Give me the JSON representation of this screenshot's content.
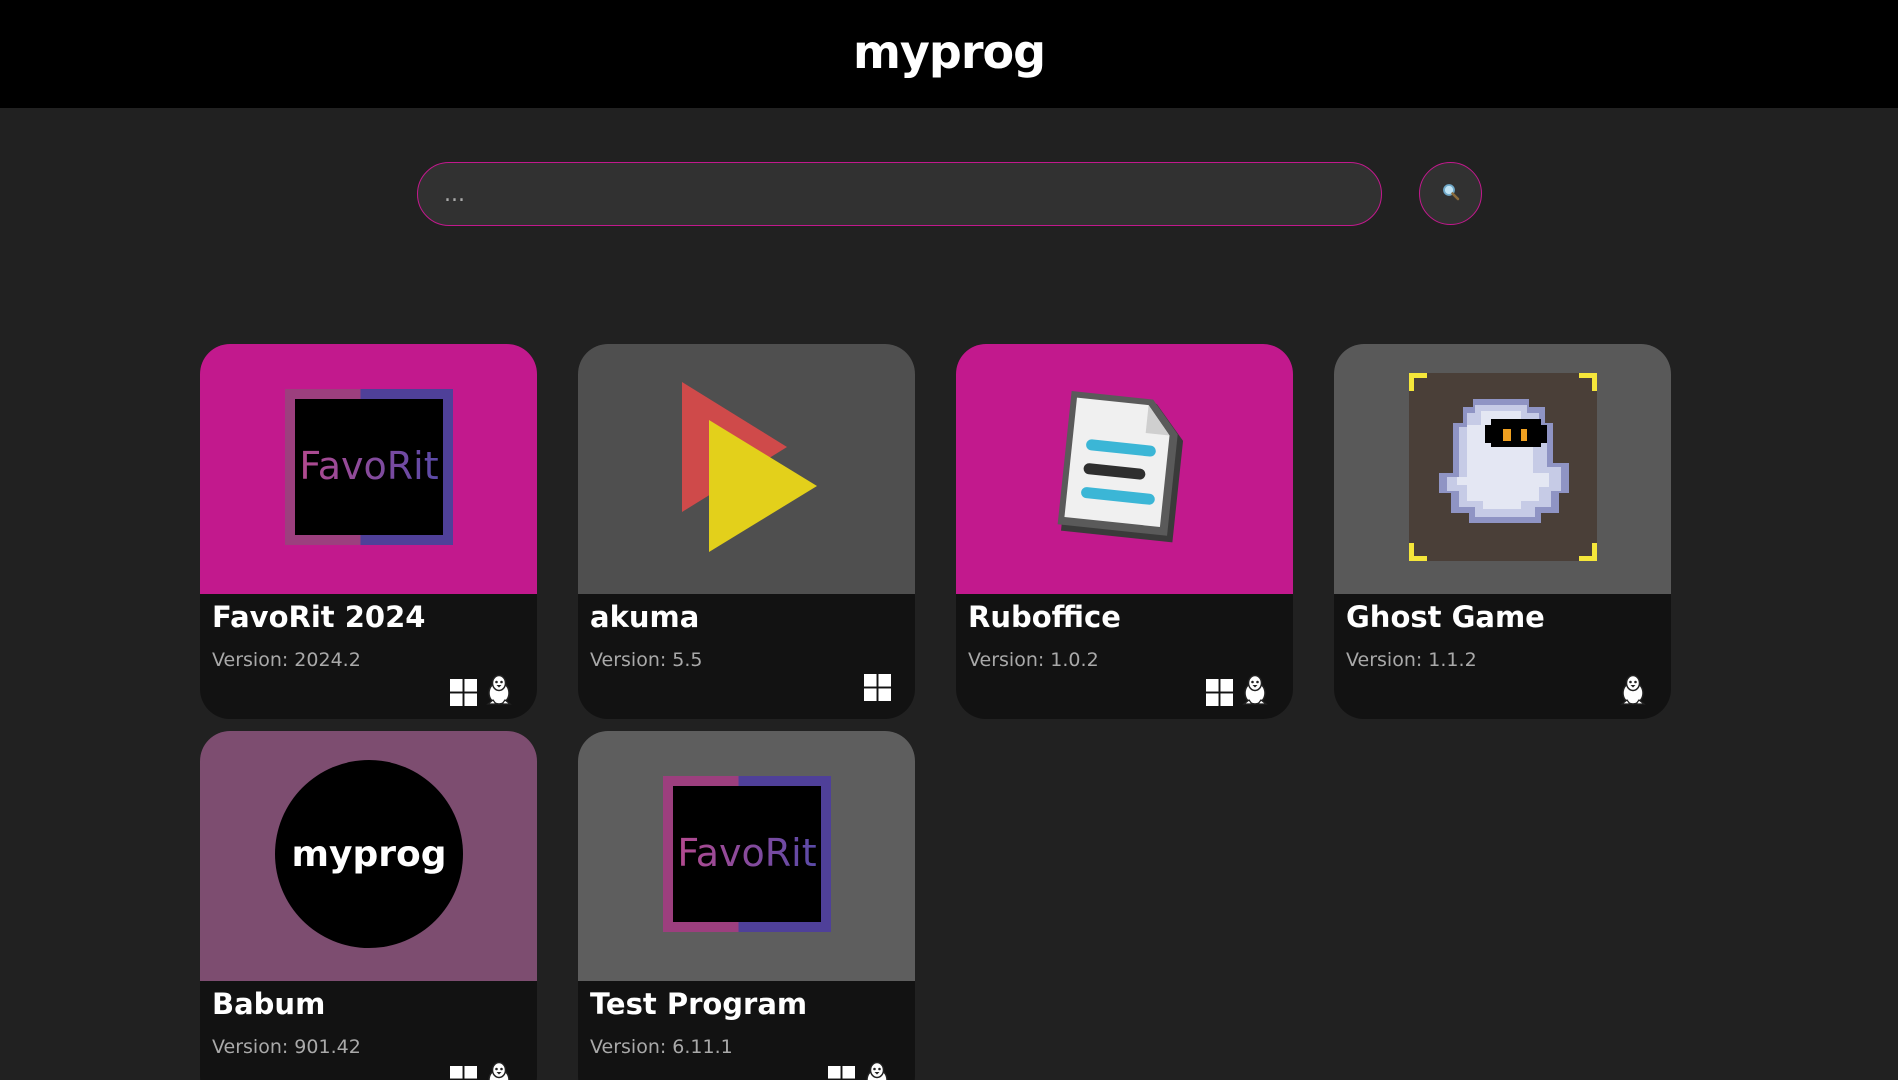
{
  "header": {
    "brand": "myprog"
  },
  "search": {
    "placeholder": "...",
    "value": "",
    "button_icon": "search-icon"
  },
  "colors": {
    "accent": "#c2198d",
    "header_bg": "#000000",
    "page_bg": "#212121",
    "card_body_bg": "#121212"
  },
  "apps": [
    {
      "title": "FavoRit 2024",
      "version": "Version: 2024.2",
      "thumb_bg": "#c2198d",
      "logo": "favorit-logo",
      "logo_text": "FavoRit",
      "platforms": [
        "windows-icon",
        "linux-icon"
      ]
    },
    {
      "title": "akuma",
      "version": "Version: 5.5",
      "thumb_bg": "#4f4f4f",
      "logo": "play-triangles-logo",
      "platforms": [
        "windows-icon"
      ]
    },
    {
      "title": "Ruboffice",
      "version": "Version: 1.0.2",
      "thumb_bg": "#c2198d",
      "logo": "document-logo",
      "platforms": [
        "windows-icon",
        "linux-icon"
      ]
    },
    {
      "title": "Ghost Game",
      "version": "Version: 1.1.2",
      "thumb_bg": "#595959",
      "logo": "pixel-ghost-logo",
      "platforms": [
        "linux-icon"
      ]
    },
    {
      "title": "Babum",
      "version": "Version: 901.42",
      "thumb_bg": "#7d4d70",
      "logo": "myprog-circle-logo",
      "logo_text": "myprog",
      "platforms": [
        "windows-icon",
        "linux-icon"
      ]
    },
    {
      "title": "Test Program",
      "version": "Version: 6.11.1",
      "thumb_bg": "#5e5e5e",
      "logo": "favorit-logo",
      "logo_text": "FavoRit",
      "platforms": [
        "windows-icon",
        "linux-icon"
      ]
    }
  ]
}
